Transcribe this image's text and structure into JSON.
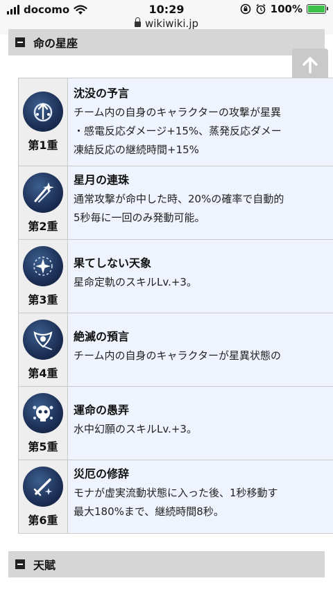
{
  "status_bar": {
    "carrier": "docomo",
    "time": "10:29",
    "url": "wikiwiki.jp",
    "battery": "100%",
    "battery_color": "#3cc24a"
  },
  "sections": {
    "constellation_title": "命の星座",
    "talent_title": "天賦"
  },
  "constellations": [
    {
      "rank": "第1重",
      "icon": "sunken-prophecy-icon",
      "title": "沈没の予言",
      "lines": [
        "チーム内の自身のキャラクターの攻撃が星異",
        "・感電反応ダメージ+15%、蒸発反応ダメー",
        "凍結反応の継続時間+15%"
      ]
    },
    {
      "rank": "第2重",
      "icon": "star-moon-icon",
      "title": "星月の連珠",
      "lines": [
        "通常攻撃が命中した時、20%の確率で自動的",
        "5秒毎に一回のみ発動可能。"
      ]
    },
    {
      "rank": "第3重",
      "icon": "star-sparkle-icon",
      "title": "果てしない天象",
      "lines": [
        "星命定軌のスキルLv.+3。"
      ]
    },
    {
      "rank": "第4重",
      "icon": "prophecy-eye-icon",
      "title": "絶滅の預言",
      "lines": [
        "チーム内の自身のキャラクターが星異状態の"
      ]
    },
    {
      "rank": "第5重",
      "icon": "skull-bubble-icon",
      "title": "運命の愚弄",
      "lines": [
        "水中幻願のスキルLv.+3。"
      ]
    },
    {
      "rank": "第6重",
      "icon": "sword-star-icon",
      "title": "災厄の修辞",
      "lines": [
        "モナが虚実流動状態に入った後、1秒移動す",
        "最大180%まで、継続時間8秒。"
      ]
    }
  ]
}
